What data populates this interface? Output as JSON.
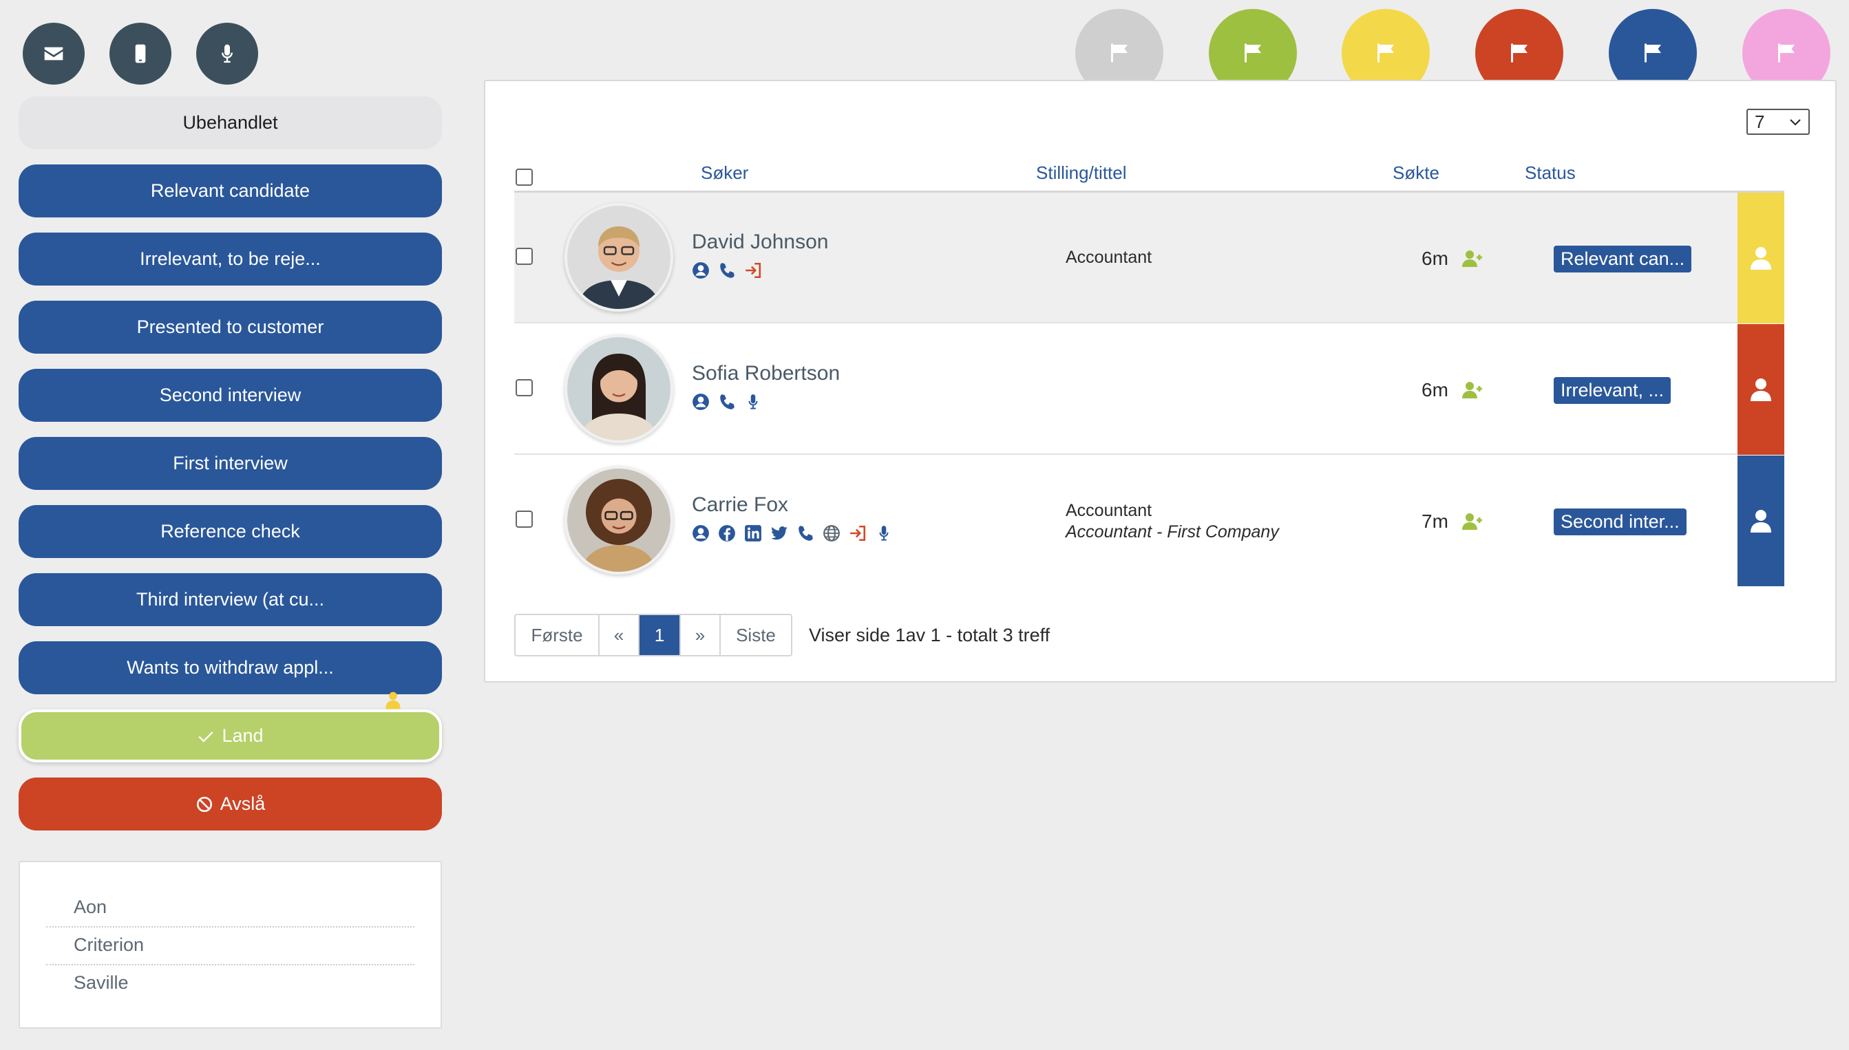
{
  "toolbar": {
    "icons": [
      "envelope-icon",
      "mobile-phone-icon",
      "microphone-icon"
    ]
  },
  "sidebar": {
    "unhandled_label": "Ubehandlet",
    "stages": [
      "Relevant candidate",
      "Irrelevant, to be reje...",
      "Presented to customer",
      "Second interview",
      "First interview",
      "Reference check",
      "Third interview (at cu...",
      "Wants to withdraw appl..."
    ],
    "land_label": "Land",
    "reject_label": "Avslå",
    "colors": {
      "stage": "#2a579a",
      "land": "#b6d06a",
      "reject": "#cc4424"
    }
  },
  "tests": [
    "Aon",
    "Criterion",
    "Saville"
  ],
  "flags": [
    {
      "name": "flag-gray",
      "color": "#cfcfcf"
    },
    {
      "name": "flag-green",
      "color": "#9ec040"
    },
    {
      "name": "flag-yellow",
      "color": "#f3d84a"
    },
    {
      "name": "flag-red",
      "color": "#cc4424"
    },
    {
      "name": "flag-blue",
      "color": "#2a579a"
    },
    {
      "name": "flag-pink",
      "color": "#f3a6de"
    }
  ],
  "table": {
    "per_page": "7",
    "headers": {
      "applicant": "Søker",
      "position": "Stilling/tittel",
      "applied": "Søkte",
      "status": "Status"
    },
    "rows": [
      {
        "name": "David Johnson",
        "icons": [
          "profile-icon",
          "phone-icon",
          "sign-in-icon"
        ],
        "position": "Accountant",
        "position_sub": "",
        "applied": "6m",
        "status": "Relevant can...",
        "bar_color": "#f3d84a"
      },
      {
        "name": "Sofia Robertson",
        "icons": [
          "profile-icon",
          "phone-icon",
          "microphone-icon"
        ],
        "position": "",
        "position_sub": "",
        "applied": "6m",
        "status": "Irrelevant, ...",
        "bar_color": "#cc4424"
      },
      {
        "name": "Carrie Fox",
        "icons": [
          "profile-icon",
          "facebook-icon",
          "linkedin-icon",
          "twitter-icon",
          "phone-icon",
          "globe-icon",
          "sign-in-icon",
          "microphone-icon"
        ],
        "position": "Accountant",
        "position_sub": "Accountant - First Company",
        "applied": "7m",
        "status": "Second inter...",
        "bar_color": "#2a579a"
      }
    ]
  },
  "pagination": {
    "first": "Første",
    "prev": "«",
    "current": "1",
    "next": "»",
    "last": "Siste",
    "info": "Viser side 1av 1 - totalt 3 treff"
  }
}
